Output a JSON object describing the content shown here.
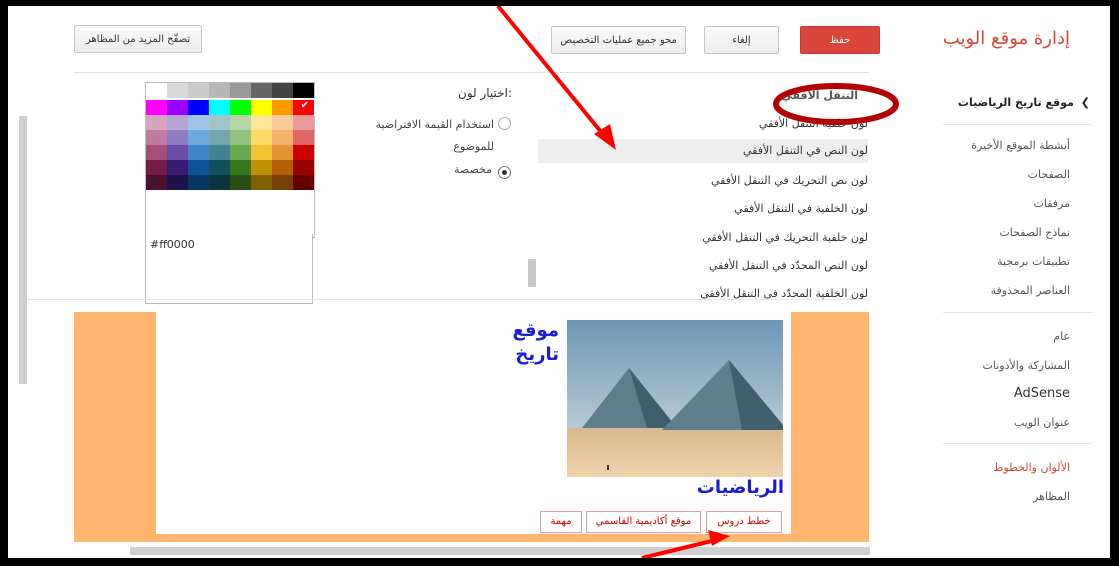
{
  "header": {
    "title": "إدارة موقع الويب",
    "save_label": "حفظ",
    "cancel_label": "إلغاء",
    "clear_label": "محو جميع عمليات التخصيص",
    "browse_label": "تصفّح المزيد من المظاهر"
  },
  "sidebar": {
    "site_name": "موقع تاريخ الرياضيات",
    "items": [
      "أنشطة الموقع الأخيرة",
      "الصفحات",
      "مرفقات",
      "نماذج الصفحات",
      "تطبيقات برمجية",
      "العناصر المحذوفة",
      "عام",
      "المشاركة والأذونات",
      "AdSense",
      "عنوان الويب",
      "الألوان والخطوط",
      "المظاهر"
    ]
  },
  "settings_list": {
    "items": [
      "التنقل الأفقي",
      "لون خلفية التنقل الأفقي",
      "لون النص في التنقل الأفقي",
      "لون نص التحريك في التنقل الأفقي",
      "لون الخلفية في التنقل الأفقي",
      "لون خلفية التحريك في التنقل الأفقي",
      "لون النص المحدّد في التنقل الأفقي",
      "لون الخلفية المحدّد في التنقل الأفقي"
    ],
    "selected_index": 2
  },
  "color_picker": {
    "label": "اختيار لون:",
    "option_default": "استخدام القيمة الافتراضية للموضوع",
    "option_custom": "مخصصة",
    "selected_option": "custom",
    "hex_value": "#ff0000",
    "grid_colors": [
      [
        "#000000",
        "#434343",
        "#666666",
        "#999999",
        "#b7b7b7",
        "#cccccc",
        "#d9d9d9",
        "#ffffff"
      ],
      [
        "#ff0000",
        "#ff9900",
        "#ffff00",
        "#00ff00",
        "#00ffff",
        "#0000ff",
        "#9900ff",
        "#ff00ff"
      ],
      [
        "#ea9999",
        "#f9cb9c",
        "#ffe599",
        "#b6d7a8",
        "#a2c4c9",
        "#9fc5e8",
        "#b4a7d6",
        "#d5a6bd"
      ],
      [
        "#e06666",
        "#f6b26b",
        "#ffd966",
        "#93c47d",
        "#76a5af",
        "#6fa8dc",
        "#8e7cc3",
        "#c27ba0"
      ],
      [
        "#cc0000",
        "#e69138",
        "#f1c232",
        "#6aa84f",
        "#45818e",
        "#3d85c6",
        "#674ea7",
        "#a64d79"
      ],
      [
        "#990000",
        "#b45f06",
        "#bf9000",
        "#38761d",
        "#134f5c",
        "#0b5394",
        "#351c75",
        "#741b47"
      ],
      [
        "#660000",
        "#783f04",
        "#7f6000",
        "#274e13",
        "#0c343d",
        "#073763",
        "#20124d",
        "#4c1130"
      ]
    ],
    "selected_color": "#ff0000"
  },
  "preview": {
    "title_line1": "موقع",
    "title_line2": "تاريخ",
    "subtitle": "الرياضيات",
    "nav": [
      "خطط دروس",
      "موقع أكاديمية القاسمي",
      "مهمة"
    ]
  },
  "colors": {
    "accent_red": "#d9453b",
    "preview_frame": "#ffb570",
    "preview_title": "#1a1adb",
    "annotation_arrow": "#ff0000",
    "annotation_circle": "#b30000"
  }
}
